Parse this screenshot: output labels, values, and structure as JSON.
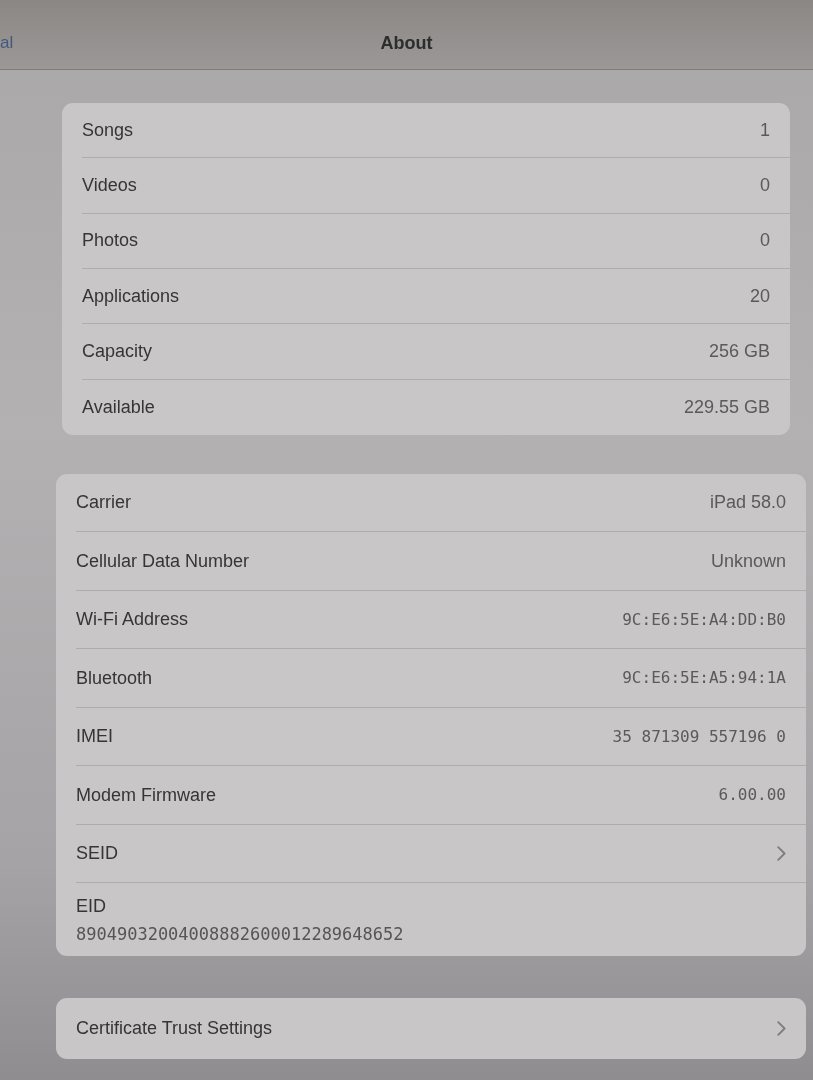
{
  "nav_bar": {
    "back_label": "al",
    "title": "About"
  },
  "sections": [
    {
      "rows": [
        {
          "kind": "text",
          "label": "Songs",
          "value": "1"
        },
        {
          "kind": "text",
          "label": "Videos",
          "value": "0"
        },
        {
          "kind": "text",
          "label": "Photos",
          "value": "0"
        },
        {
          "kind": "text",
          "label": "Applications",
          "value": "20"
        },
        {
          "kind": "text",
          "label": "Capacity",
          "value": "256 GB"
        },
        {
          "kind": "text",
          "label": "Available",
          "value": "229.55 GB"
        }
      ]
    },
    {
      "rows": [
        {
          "kind": "text",
          "label": "Carrier",
          "value": "iPad 58.0"
        },
        {
          "kind": "text",
          "label": "Cellular Data Number",
          "value": "Unknown"
        },
        {
          "kind": "code",
          "label": "Wi-Fi Address",
          "value": "9C:E6:5E:A4:DD:B0"
        },
        {
          "kind": "code",
          "label": "Bluetooth",
          "value": "9C:E6:5E:A5:94:1A"
        },
        {
          "kind": "code",
          "label": "IMEI",
          "value": "35 871309 557196 0"
        },
        {
          "kind": "code",
          "label": "Modem Firmware",
          "value": "6.00.00"
        },
        {
          "kind": "link",
          "label": "SEID"
        },
        {
          "kind": "stacked",
          "label": "EID",
          "value": "89049032004008882600012289648652"
        }
      ]
    },
    {
      "rows": [
        {
          "kind": "link",
          "label": "Certificate Trust Settings"
        }
      ]
    }
  ]
}
